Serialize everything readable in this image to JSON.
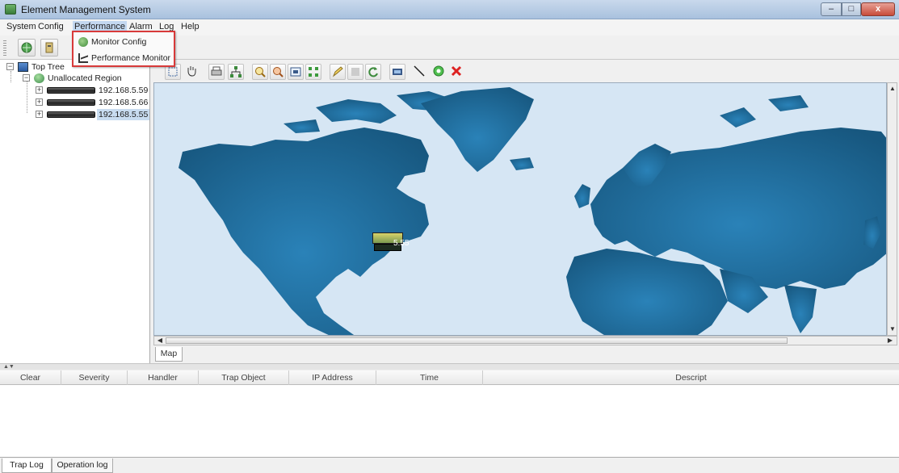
{
  "window": {
    "title": "Element Management System"
  },
  "menubar": {
    "items": [
      "System",
      "Config",
      "Performance",
      "Alarm",
      "Log",
      "Help"
    ]
  },
  "dropdown": {
    "items": [
      {
        "label": "Monitor Config",
        "icon": "monitor-config-icon"
      },
      {
        "label": "Performance Monitor",
        "icon": "chart-icon"
      }
    ]
  },
  "tree": {
    "root": "Top Tree",
    "region": "Unallocated Region",
    "devices": [
      "192.168.5.59",
      "192.168.5.66",
      "192.168.5.55"
    ],
    "selected_index": 2
  },
  "map": {
    "tab_label": "Map",
    "node_label": "5.55",
    "colors": {
      "ocean": "#d6e6f4",
      "land": "#1f6a9a"
    }
  },
  "log_table": {
    "columns": [
      "Clear",
      "Severity",
      "Handler",
      "Trap Object",
      "IP Address",
      "Time",
      "Descript"
    ]
  },
  "bottom_tabs": [
    "Trap Log",
    "Operation log"
  ]
}
